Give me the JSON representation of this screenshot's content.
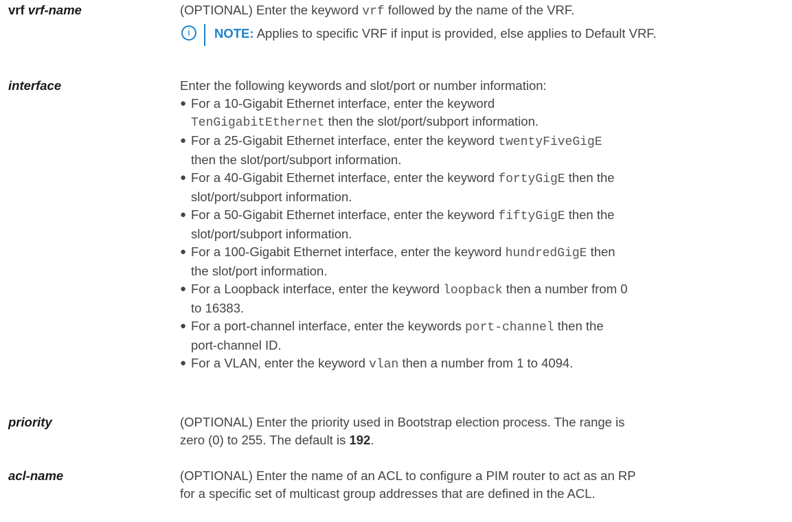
{
  "entries": {
    "vrf": {
      "term_bold": "vrf",
      "term_italic": "vrf-name",
      "desc_pre": "(OPTIONAL) Enter the keyword",
      "desc_code": "vrf",
      "desc_post": "followed by the name of the VRF.",
      "note_icon": "i",
      "note_label": "NOTE:",
      "note_text": "Applies to specific VRF if input is provided, else applies to Default VRF."
    },
    "interface": {
      "term": "interface",
      "intro": "Enter the following keywords and slot/port or number information:",
      "bullet_char": "●",
      "items": [
        {
          "lines": [
            {
              "pre": "For a 10-Gigabit Ethernet interface, enter the keyword",
              "code": "",
              "post": ""
            },
            {
              "pre": "",
              "code": "TenGigabitEthernet",
              "post": "then the slot/port/subport information."
            }
          ]
        },
        {
          "lines": [
            {
              "pre": "For a 25-Gigabit Ethernet interface, enter the keyword",
              "code": "twentyFiveGigE",
              "post": ""
            },
            {
              "pre": "then the slot/port/subport information.",
              "code": "",
              "post": ""
            }
          ]
        },
        {
          "lines": [
            {
              "pre": "For a 40-Gigabit Ethernet interface, enter the keyword",
              "code": "fortyGigE",
              "post": "then the"
            },
            {
              "pre": "slot/port/subport information.",
              "code": "",
              "post": ""
            }
          ]
        },
        {
          "lines": [
            {
              "pre": "For a 50-Gigabit Ethernet interface, enter the keyword",
              "code": "fiftyGigE",
              "post": "then the"
            },
            {
              "pre": "slot/port/subport information.",
              "code": "",
              "post": ""
            }
          ]
        },
        {
          "lines": [
            {
              "pre": "For a 100-Gigabit Ethernet interface, enter the keyword",
              "code": "hundredGigE",
              "post": "then"
            },
            {
              "pre": "the slot/port information.",
              "code": "",
              "post": ""
            }
          ]
        },
        {
          "lines": [
            {
              "pre": "For a Loopback interface, enter the keyword",
              "code": "loopback",
              "post": "then a number from 0"
            },
            {
              "pre": "to 16383.",
              "code": "",
              "post": ""
            }
          ]
        },
        {
          "lines": [
            {
              "pre": "For a port-channel interface, enter the keywords",
              "code": "port-channel",
              "post": "then the"
            },
            {
              "pre": "port-channel ID.",
              "code": "",
              "post": ""
            }
          ]
        },
        {
          "lines": [
            {
              "pre": "For a VLAN, enter the keyword",
              "code": "vlan",
              "post": "then a number from 1 to 4094."
            }
          ]
        }
      ]
    },
    "priority": {
      "term": "priority",
      "line1": "(OPTIONAL) Enter the priority used in Bootstrap election process. The range is",
      "line2_pre": "zero (0) to 255. The default is",
      "line2_bold": "192",
      "line2_post": "."
    },
    "acl": {
      "term": "acl-name",
      "line1": "(OPTIONAL) Enter the name of an ACL to configure a PIM router to act as an RP",
      "line2": "for a specific set of multicast group addresses that are defined in the ACL."
    }
  }
}
